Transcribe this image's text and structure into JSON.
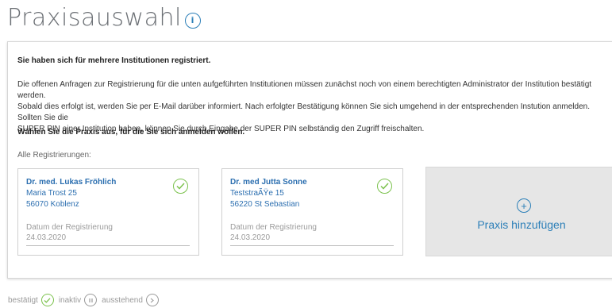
{
  "page": {
    "title": "Praxisauswahl"
  },
  "panel": {
    "registered_heading": "Sie haben sich für mehrere Institutionen registriert.",
    "paragraph_lines": [
      "Die offenen Anfragen zur Registrierung für die unten aufgeführten Institutionen müssen zunächst noch von einem berechtigten Administrator der Institution bestätigt werden.",
      "Sobald dies erfolgt ist, werden Sie per E-Mail darüber informiert. Nach erfolgter Bestätigung können Sie sich umgehend in der entsprechenden Instution anmelden. Sollten Sie die",
      "SUPER PIN einer Institution haben, können Sie durch Eingabe der SUPER PIN selbständig den Zugriff freischalten."
    ],
    "choose_heading": "Wählen Sie die Praxis aus, für die Sie sich anmelden wollen.",
    "all_registrations_label": "Alle Registrierungen:",
    "cards": [
      {
        "name": "Dr. med. Lukas Fröhlich",
        "street": "Maria Trost 25",
        "city": "56070 Koblenz",
        "date_label": "Datum der Registrierung",
        "date": "24.03.2020",
        "status_icon": "check-circle-icon"
      },
      {
        "name": "Dr. med Jutta Sonne",
        "street": "TeststraÃŸe 15",
        "city": "56220 St Sebastian",
        "date_label": "Datum der Registrierung",
        "date": "24.03.2020",
        "status_icon": "check-circle-icon"
      }
    ],
    "add_card": {
      "label": "Praxis hinzufügen"
    }
  },
  "legend": {
    "confirmed": "bestätigt",
    "inactive": "inaktiv",
    "pending": "ausstehend"
  },
  "colors": {
    "accent": "#2c7fb8",
    "confirmed": "#7cc24e",
    "muted": "#9a9a9a"
  }
}
